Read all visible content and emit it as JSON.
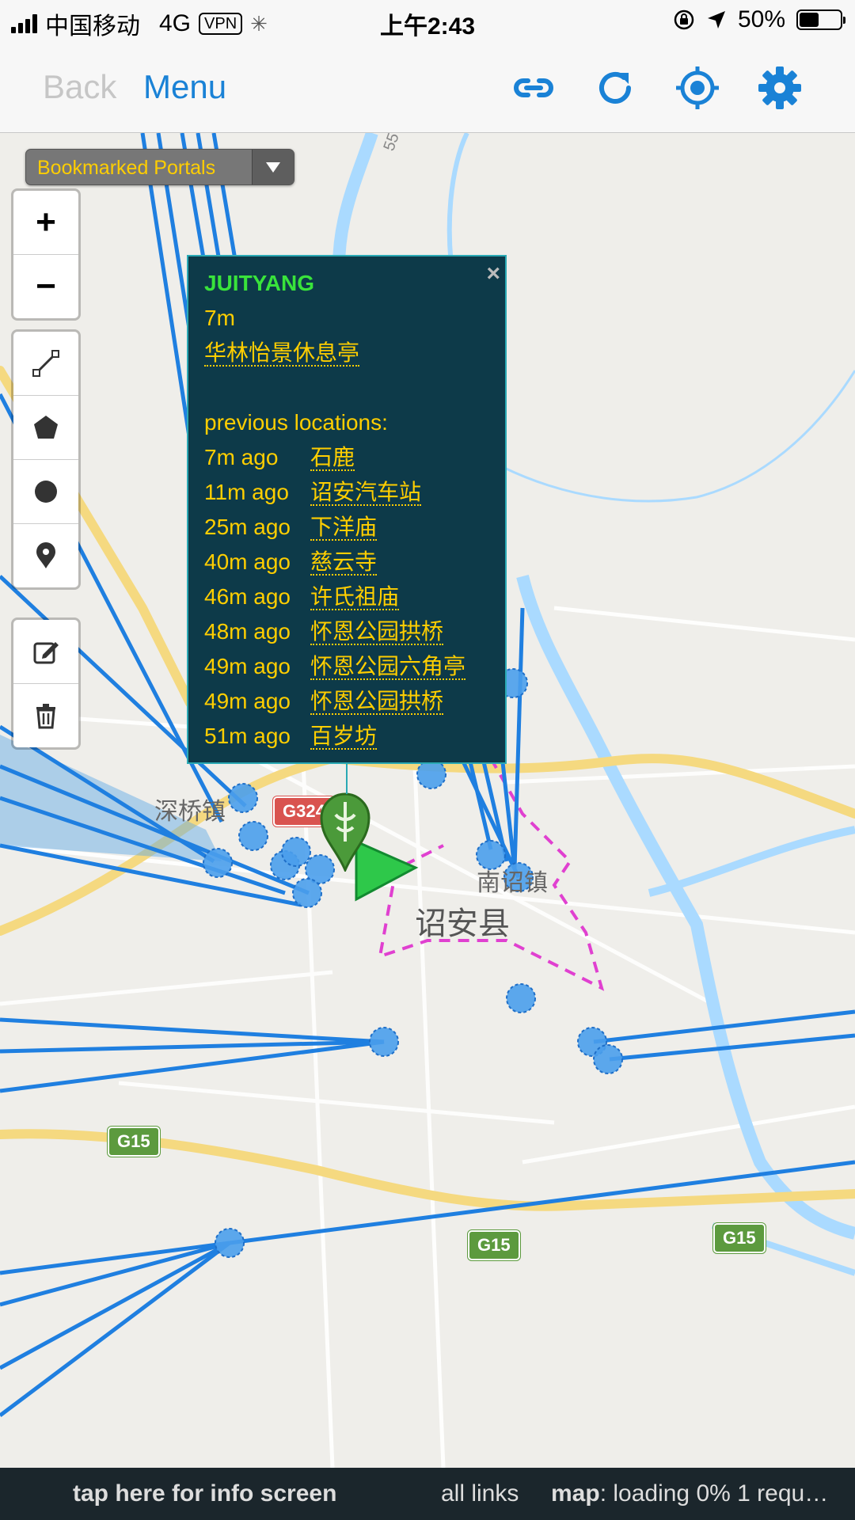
{
  "status_bar": {
    "carrier": "中国移动",
    "network": "4G",
    "vpn": "VPN",
    "time": "上午2:43",
    "battery": "50%",
    "battery_level": 0.5
  },
  "nav": {
    "back_label": "Back",
    "menu_label": "Menu",
    "icons": [
      "link-icon",
      "refresh-icon",
      "locate-icon",
      "gear-icon"
    ],
    "accent_color": "#1a82d6"
  },
  "layer_chooser": {
    "selected": "Bookmarked Portals"
  },
  "map_controls": {
    "zoom_in": "+",
    "zoom_out": "−",
    "draw_tools": [
      "polyline-icon",
      "polygon-icon",
      "circle-icon",
      "marker-icon"
    ],
    "edit_tools": [
      "edit-icon",
      "trash-icon"
    ]
  },
  "popup": {
    "close": "×",
    "agent": "JUITYANG",
    "age": "7m",
    "portal": "华林怡景休息亭",
    "history_title": "previous locations:",
    "history": [
      {
        "time": "7m ago",
        "place": "石鹿"
      },
      {
        "time": "11m ago",
        "place": "诏安汽车站"
      },
      {
        "time": "25m ago",
        "place": "下洋庙"
      },
      {
        "time": "40m ago",
        "place": "慈云寺"
      },
      {
        "time": "46m ago",
        "place": "许氏祖庙"
      },
      {
        "time": "48m ago",
        "place": "怀恩公园拱桥"
      },
      {
        "time": "49m ago",
        "place": "怀恩公园六角亭"
      },
      {
        "time": "49m ago",
        "place": "怀恩公园拱桥"
      },
      {
        "time": "51m ago",
        "place": "百岁坊"
      }
    ]
  },
  "map_labels": {
    "town1": "深桥镇",
    "town2": "南诏镇",
    "county": "诏安县",
    "road_g324": "G324",
    "road_g15": "G15",
    "road_55": "55"
  },
  "bottom_bar": {
    "info": "tap here for info screen",
    "links": "all links",
    "map_key": "map",
    "map_status": ": loading 0% 1 requ…"
  }
}
